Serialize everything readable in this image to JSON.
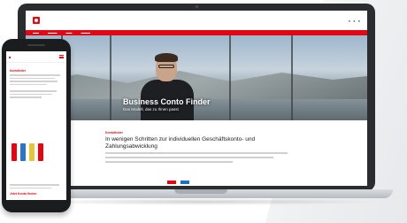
{
  "colors": {
    "brand_red": "#e30613",
    "device_frame": "#1b1c1e"
  },
  "laptop": {
    "hero": {
      "title": "Business Conto Finder",
      "subtitle": "Das Modell, das zu Ihnen passt"
    },
    "section_label": "Kontofinder",
    "heading": "In wenigen Schritten zur individuellen Geschäftskonto- und Zahlungsabwicklung"
  },
  "phone": {
    "section_label": "Kontofinder",
    "cta": "Jetzt Konto finden"
  },
  "icons": [
    "logo-mark-icon",
    "menu-icon"
  ]
}
